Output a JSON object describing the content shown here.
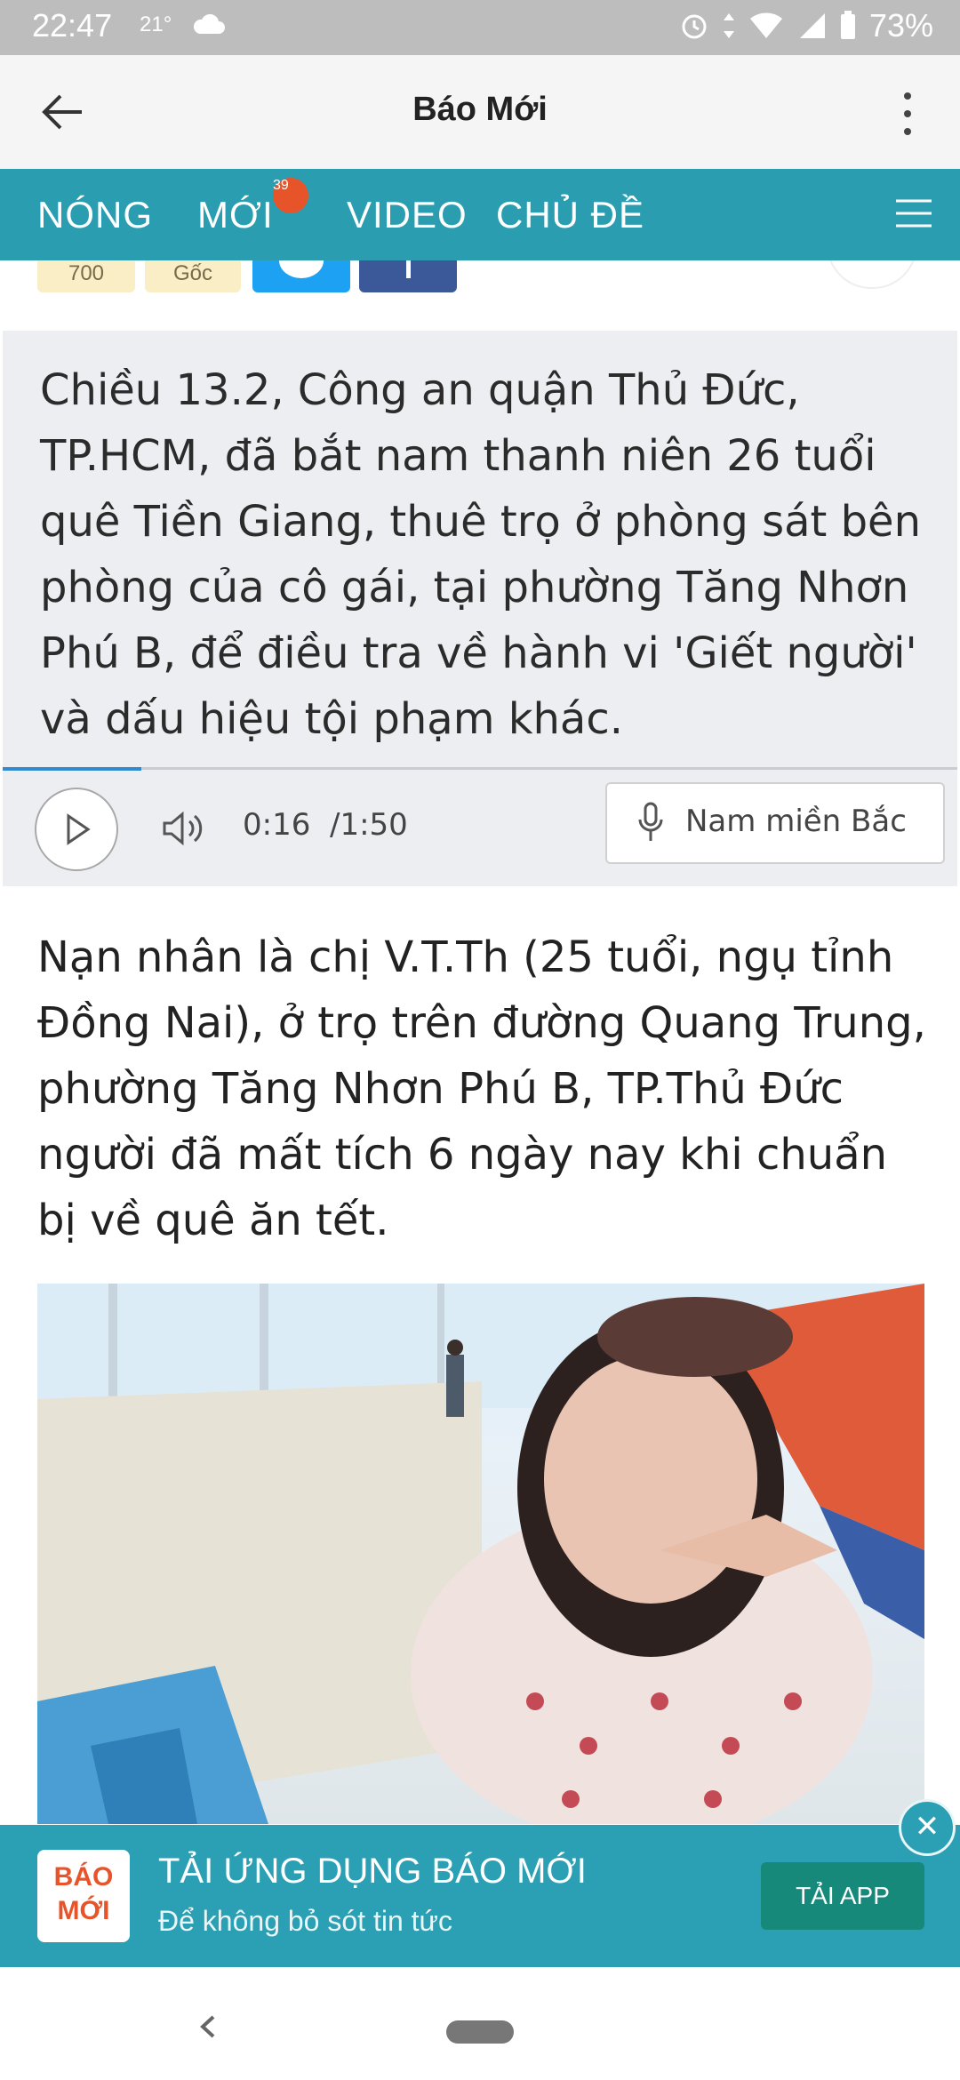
{
  "status_bar": {
    "time": "22:47",
    "temperature": "21°",
    "battery": "73%"
  },
  "app_bar": {
    "title": "Báo Mới"
  },
  "nav": {
    "tabs": [
      {
        "label": "NÓNG"
      },
      {
        "label": "MỚI"
      },
      {
        "label": "VIDEO"
      },
      {
        "label": "CHỦ ĐỀ"
      }
    ],
    "new_badge": "39"
  },
  "article_actions": {
    "count_label": "700",
    "source_label": "Gốc"
  },
  "summary": {
    "text": "Chiều 13.2, Công an quận Thủ Đức, TP.HCM, đã bắt nam thanh niên 26 tuổi quê Tiền Giang, thuê trọ ở phòng sát bên phòng của cô gái, tại phường Tăng Nhơn Phú B, để điều tra về hành vi 'Giết người' và dấu hiệu tội phạm khác."
  },
  "audio_player": {
    "current_time": "0:16",
    "total_time": "/1:50",
    "voice_label": "Nam miền Bắc",
    "progress": 0.145
  },
  "article": {
    "paragraph": "Nạn nhân là chị V.T.Th (25 tuổi, ngụ tỉnh Đồng Nai), ở trọ trên đường Quang Trung, phường Tăng Nhơn Phú B, TP.Thủ Đức người đã mất tích 6 ngày nay khi chuẩn bị về quê ăn tết."
  },
  "app_banner": {
    "logo_line1": "BÁO",
    "logo_line2": "MỚI",
    "title": "TẢI ỨNG DỤNG BÁO MỚI",
    "subtitle": "Để không bỏ sót tin tức",
    "cta": "TẢI APP",
    "close": "✕"
  },
  "colors": {
    "nav_bg": "#2a9db0",
    "badge": "#e8542a",
    "banner_bg": "#2b9fb3",
    "cta_bg": "#16897b"
  }
}
